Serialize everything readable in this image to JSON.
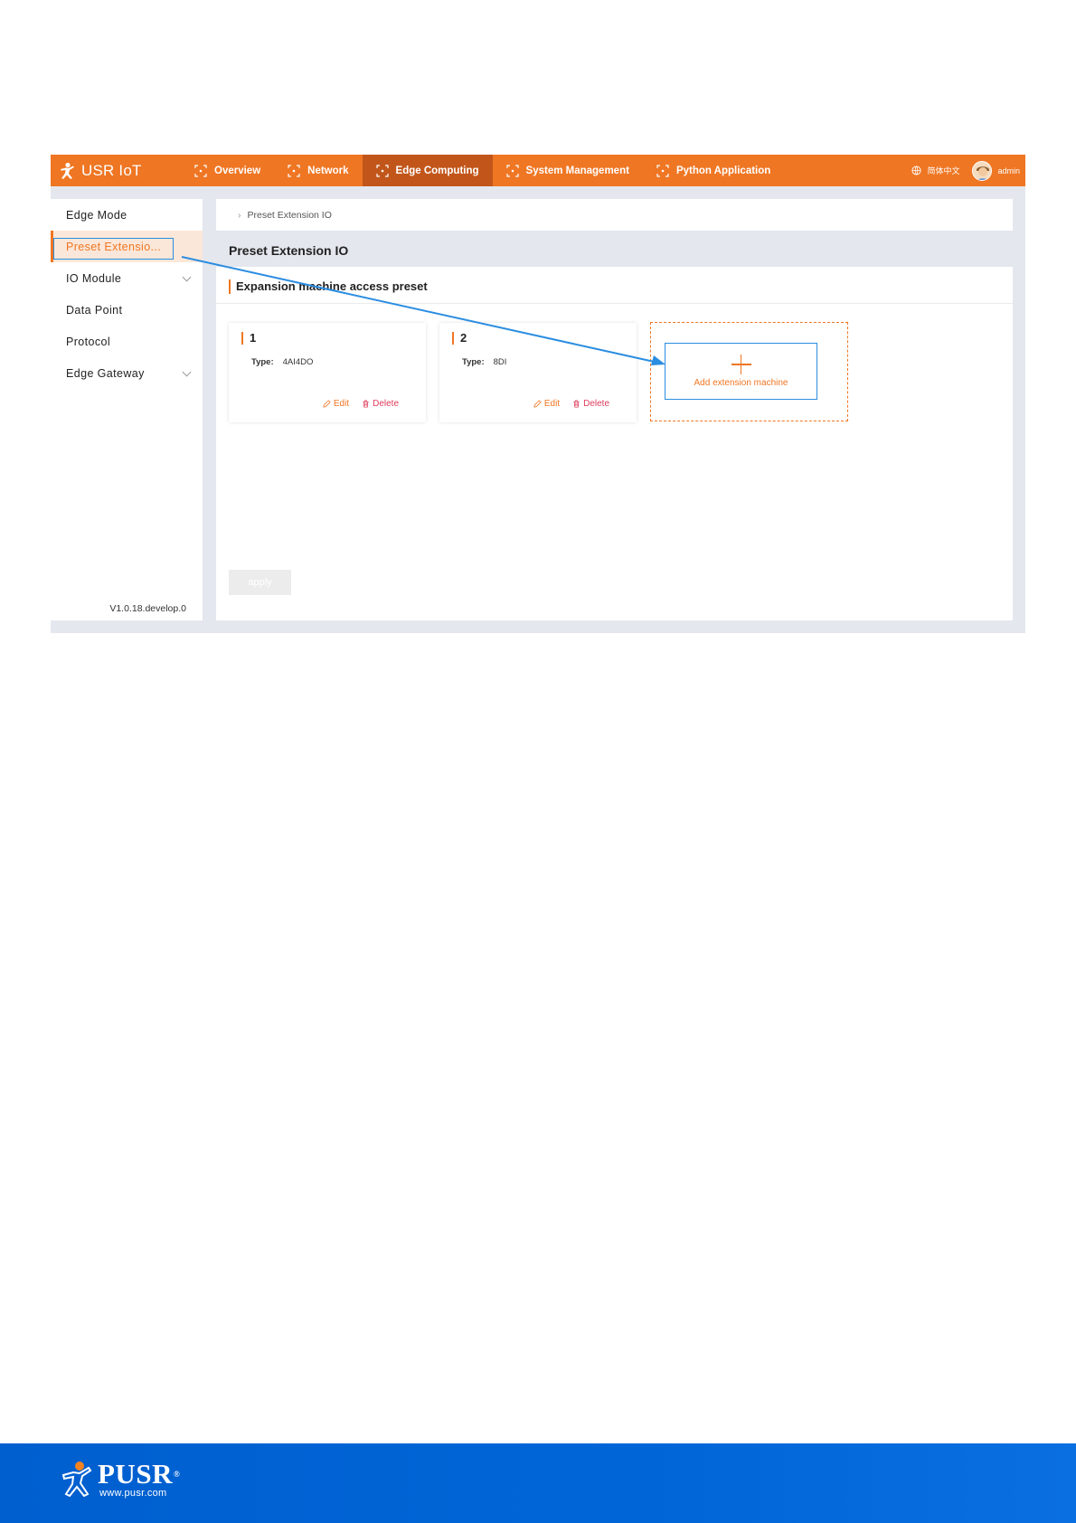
{
  "header": {
    "brand": "USR IoT",
    "nav": [
      {
        "label": "Overview"
      },
      {
        "label": "Network"
      },
      {
        "label": "Edge Computing"
      },
      {
        "label": "System Management"
      },
      {
        "label": "Python Application"
      }
    ],
    "active_nav": "Edge Computing",
    "language": "简体中文",
    "user": "admin"
  },
  "sidebar": {
    "items": [
      {
        "label": "Edge Mode"
      },
      {
        "label": "Preset Extensio..."
      },
      {
        "label": "IO Module"
      },
      {
        "label": "Data Point"
      },
      {
        "label": "Protocol"
      },
      {
        "label": "Edge Gateway"
      }
    ],
    "active": "Preset Extensio...",
    "version": "V1.0.18.develop.0"
  },
  "breadcrumb": {
    "current": "Preset Extension IO"
  },
  "page": {
    "title": "Preset Extension IO",
    "section_title": "Expansion machine access preset",
    "cards": [
      {
        "index": "1",
        "type_label": "Type:",
        "type_value": "4AI4DO",
        "edit": "Edit",
        "delete": "Delete"
      },
      {
        "index": "2",
        "type_label": "Type:",
        "type_value": "8DI",
        "edit": "Edit",
        "delete": "Delete"
      }
    ],
    "add_label": "Add extension machine",
    "apply_label": "apply"
  },
  "footer": {
    "brand": "PUSR",
    "registered": "®",
    "url": "www.pusr.com"
  },
  "colors": {
    "accent": "#ef7623",
    "active_nav": "#c2561a",
    "annotation": "#2b8de0",
    "delete": "#e03c5a",
    "footer": "#0066d8"
  }
}
